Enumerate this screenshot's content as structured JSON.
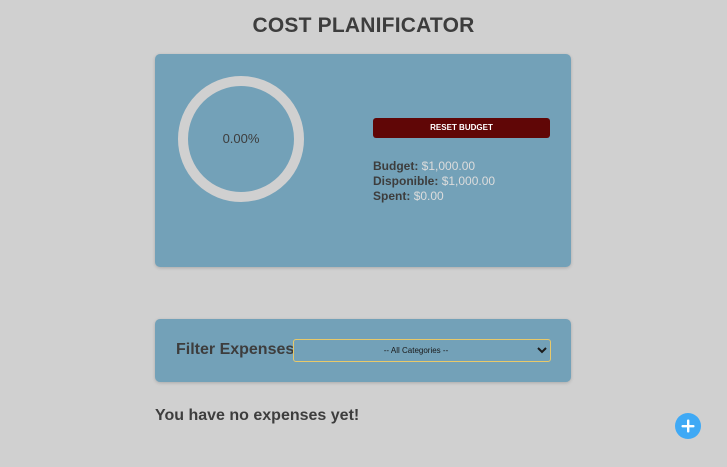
{
  "header": {
    "title": "COST PLANIFICATOR"
  },
  "budget": {
    "progress_text": "0.00%",
    "progress_fraction": 0,
    "reset_label": "RESET BUDGET",
    "budget_label": "Budget:",
    "budget_value": "$1,000.00",
    "disponible_label": "Disponible:",
    "disponible_value": "$1,000.00",
    "spent_label": "Spent:",
    "spent_value": "$0.00"
  },
  "filter": {
    "label": "Filter Expenses",
    "selected": "-- All Categories --",
    "options": [
      "-- All Categories --"
    ]
  },
  "expenses": {
    "empty_message": "You have no expenses yet!"
  },
  "colors": {
    "background": "#d0d0d0",
    "card": "#73a1b8",
    "reset_button": "#600606",
    "add_button": "#3fa9f5",
    "ring_track": "#d0d0d0"
  },
  "icons": {
    "add": "plus-icon"
  }
}
